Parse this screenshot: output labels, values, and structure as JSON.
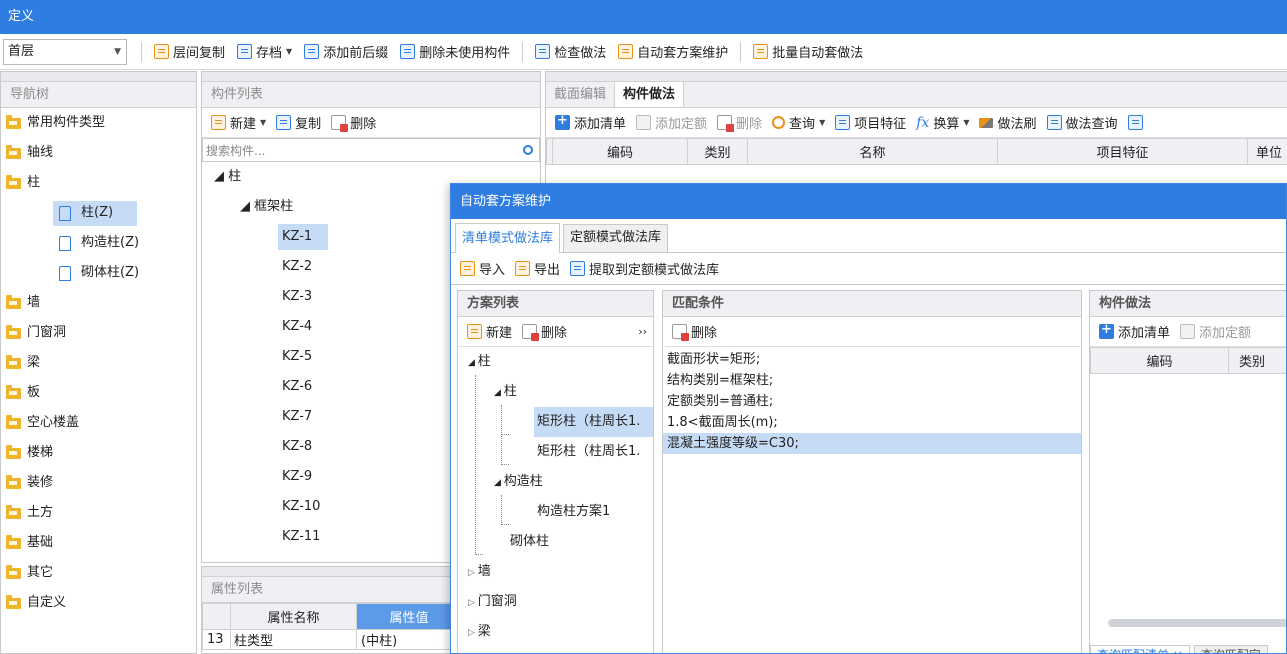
{
  "window": {
    "title": "定义"
  },
  "toolbar": {
    "floor": "首层",
    "buttons": [
      {
        "label": "层间复制",
        "icon": "copy-floor-icon",
        "dropdown": false
      },
      {
        "label": "存档",
        "icon": "archive-icon",
        "dropdown": true
      },
      {
        "label": "添加前后缀",
        "icon": "add-prefix-icon",
        "dropdown": false
      },
      {
        "label": "删除未使用构件",
        "icon": "delete-unused-icon",
        "dropdown": false
      },
      {
        "label": "检查做法",
        "icon": "check-method-icon",
        "dropdown": false
      },
      {
        "label": "自动套方案维护",
        "icon": "auto-scheme-icon",
        "dropdown": false
      },
      {
        "label": "批量自动套做法",
        "icon": "batch-auto-icon",
        "dropdown": false
      }
    ]
  },
  "nav": {
    "title": "导航树",
    "items": [
      {
        "label": "常用构件类型",
        "level": 0
      },
      {
        "label": "轴线",
        "level": 0
      },
      {
        "label": "柱",
        "level": 0,
        "expanded": true
      },
      {
        "label": "柱(Z)",
        "level": 1,
        "selected": true
      },
      {
        "label": "构造柱(Z)",
        "level": 1
      },
      {
        "label": "砌体柱(Z)",
        "level": 1
      },
      {
        "label": "墙",
        "level": 0
      },
      {
        "label": "门窗洞",
        "level": 0
      },
      {
        "label": "梁",
        "level": 0
      },
      {
        "label": "板",
        "level": 0
      },
      {
        "label": "空心楼盖",
        "level": 0
      },
      {
        "label": "楼梯",
        "level": 0
      },
      {
        "label": "装修",
        "level": 0
      },
      {
        "label": "土方",
        "level": 0
      },
      {
        "label": "基础",
        "level": 0
      },
      {
        "label": "其它",
        "level": 0
      },
      {
        "label": "自定义",
        "level": 0
      }
    ]
  },
  "components": {
    "title": "构件列表",
    "new_label": "新建",
    "copy_label": "复制",
    "delete_label": "删除",
    "search_placeholder": "搜索构件...",
    "root": "柱",
    "group": "框架柱",
    "items": [
      "KZ-1",
      "KZ-2",
      "KZ-3",
      "KZ-4",
      "KZ-5",
      "KZ-6",
      "KZ-7",
      "KZ-8",
      "KZ-9",
      "KZ-10",
      "KZ-11"
    ],
    "selected": "KZ-1"
  },
  "properties": {
    "title": "属性列表",
    "col_name": "属性名称",
    "col_value": "属性值",
    "rows": [
      {
        "index": "13",
        "name": "柱类型",
        "value": "(中柱)"
      }
    ]
  },
  "method": {
    "tabs": [
      "截面编辑",
      "构件做法"
    ],
    "active_tab": "构件做法",
    "buttons": [
      "添加清单",
      "添加定额",
      "删除",
      "查询",
      "项目特征",
      "换算",
      "做法刷",
      "做法查询"
    ],
    "columns": [
      "编码",
      "类别",
      "名称",
      "项目特征",
      "单位"
    ]
  },
  "dialog": {
    "title": "自动套方案维护",
    "tabs": [
      "清单模式做法库",
      "定额模式做法库"
    ],
    "active_tab": "清单模式做法库",
    "toolbar": {
      "import": "导入",
      "export": "导出",
      "extract": "提取到定额模式做法库"
    },
    "scheme": {
      "title": "方案列表",
      "new_label": "新建",
      "delete_label": "删除",
      "more": "››",
      "tree": {
        "root": "柱",
        "col": "柱",
        "leaf1": "矩形柱（柱周长1.",
        "leaf2": "矩形柱（柱周长1.",
        "struct": "构造柱",
        "struct_leaf": "构造柱方案1",
        "masonry": "砌体柱",
        "wall": "墙",
        "door": "门窗洞",
        "beam": "梁"
      }
    },
    "match": {
      "title": "匹配条件",
      "delete_label": "删除",
      "conditions": [
        "截面形状=矩形;",
        "结构类别=框架柱;",
        "定额类别=普通柱;",
        "1.8<截面周长(m);",
        "混凝土强度等级=C30;"
      ],
      "selected_index": 4
    },
    "comp_method": {
      "title": "构件做法",
      "add_list": "添加清单",
      "add_quota": "添加定额",
      "columns": [
        "编码",
        "类别"
      ],
      "bottom_tabs": [
        "查询匹配清单 ×",
        "查询匹配定"
      ]
    }
  }
}
